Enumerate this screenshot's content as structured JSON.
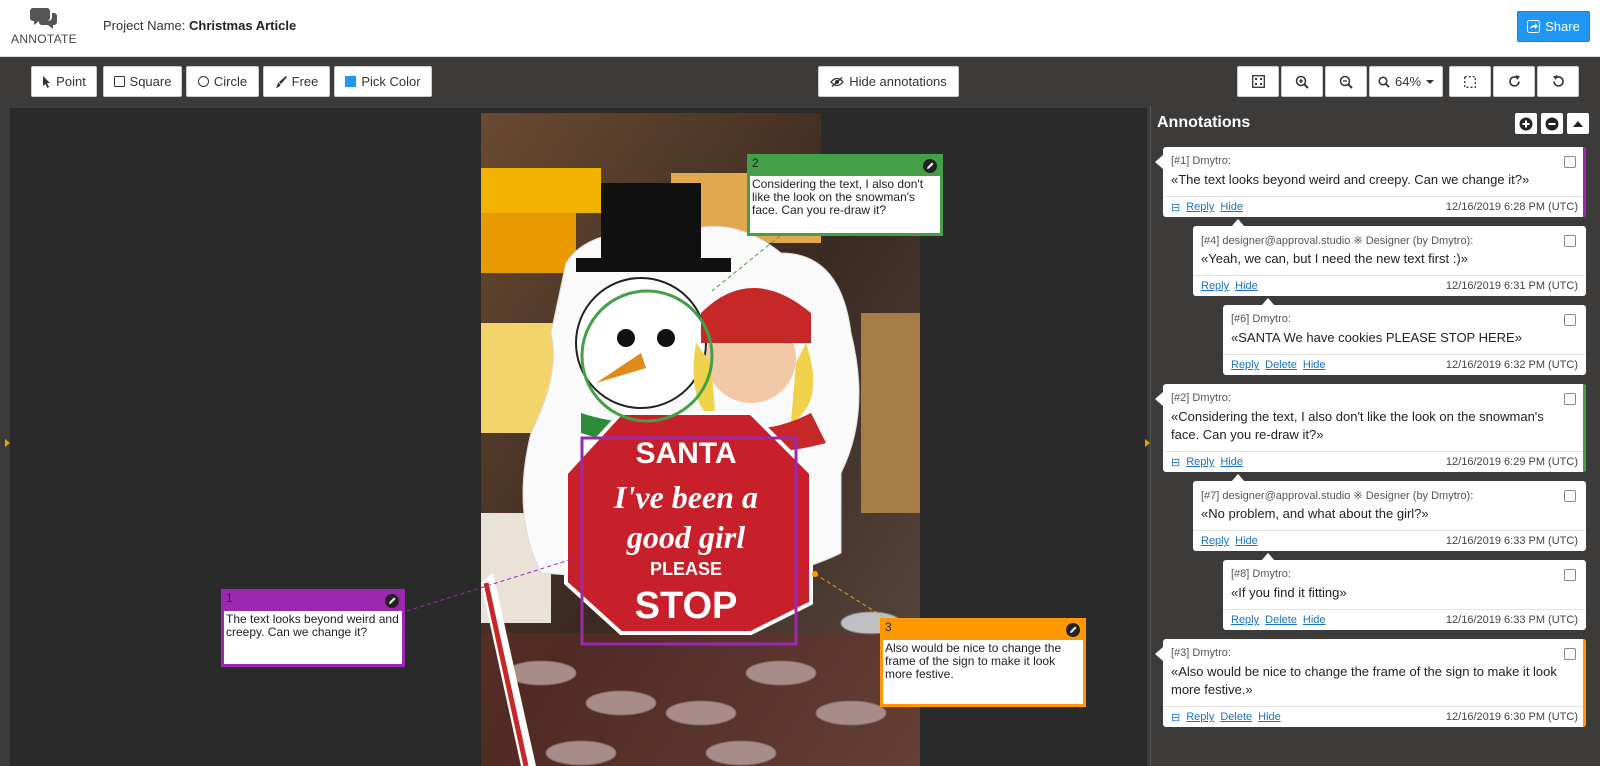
{
  "header": {
    "logo_text": "ANNOTATE",
    "project_label": "Project Name:",
    "project_name": "Christmas Article",
    "share_label": "Share"
  },
  "toolbar": {
    "point": "Point",
    "square": "Square",
    "circle": "Circle",
    "free": "Free",
    "pick_color": "Pick Color",
    "pick_color_swatch": "#2196f3",
    "hide_annotations": "Hide annotations",
    "zoom_level": "64%"
  },
  "canvas_notes": [
    {
      "num": "1",
      "text": "The text looks beyond weird and creepy. Can we change it?",
      "color": "#9c27b0"
    },
    {
      "num": "2",
      "text": "Considering the text, I also don't like the look on the snowman's face. Can you re-draw it?",
      "color": "#43a047"
    },
    {
      "num": "3",
      "text": "Also would be nice to change the frame of the sign to make it look more festive.",
      "color": "#ff9800"
    }
  ],
  "sign": {
    "line1": "SANTA",
    "line2": "I've been a",
    "line3": "good girl",
    "line4": "PLEASE",
    "line5": "STOP"
  },
  "sidebar": {
    "title": "Annotations",
    "comments": [
      {
        "meta": "[#1] Dmytro:",
        "text": "«The text looks beyond weird and creepy. Can we change it?»",
        "reply": "Reply",
        "hide": "Hide",
        "time": "12/16/2019 6:28 PM (UTC)",
        "color": "#9c27b0"
      },
      {
        "meta": "[#4] designer@approval.studio ※ Designer (by Dmytro):",
        "text": "«Yeah, we can, but I need the new text first :)»",
        "reply": "Reply",
        "hide": "Hide",
        "time": "12/16/2019 6:31 PM (UTC)"
      },
      {
        "meta": "[#6] Dmytro:",
        "text": "«SANTA We have cookies PLEASE STOP HERE»",
        "reply": "Reply",
        "delete": "Delete",
        "hide": "Hide",
        "time": "12/16/2019 6:32 PM (UTC)"
      },
      {
        "meta": "[#2] Dmytro:",
        "text": "«Considering the text, I also don't like the look on the snowman's face. Can you re-draw it?»",
        "reply": "Reply",
        "hide": "Hide",
        "time": "12/16/2019 6:29 PM (UTC)",
        "color": "#43a047"
      },
      {
        "meta": "[#7] designer@approval.studio ※ Designer (by Dmytro):",
        "text": "«No problem, and what about the girl?»",
        "reply": "Reply",
        "hide": "Hide",
        "time": "12/16/2019 6:33 PM (UTC)"
      },
      {
        "meta": "[#8] Dmytro:",
        "text": "«If you find it fitting»",
        "reply": "Reply",
        "delete": "Delete",
        "hide": "Hide",
        "time": "12/16/2019 6:33 PM (UTC)"
      },
      {
        "meta": "[#3] Dmytro:",
        "text": "«Also would be nice to change the frame of the sign to make it look more festive.»",
        "reply": "Reply",
        "delete": "Delete",
        "hide": "Hide",
        "time": "12/16/2019 6:30 PM (UTC)",
        "color": "#ff9800"
      }
    ]
  }
}
